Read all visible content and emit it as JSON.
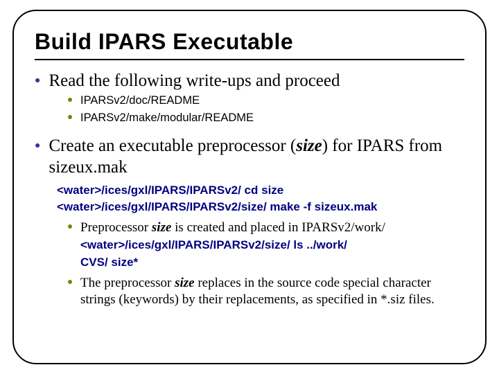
{
  "title": "Build IPARS Executable",
  "items": [
    {
      "text": "Read the following write-ups and proceed",
      "sub": [
        {
          "text": "IPARSv2/doc/README"
        },
        {
          "text": "IPARSv2/make/modular/README"
        }
      ]
    },
    {
      "text_pre": "Create an executable preprocessor (",
      "text_em": "size",
      "text_post": ") for IPARS from sizeux.mak",
      "code1": "<water>/ices/gxl/IPARS/IPARSv2/   cd size",
      "code2": "<water>/ices/gxl/IPARS/IPARSv2/size/   make -f sizeux.mak",
      "sub2": [
        {
          "pre": "Preprocessor ",
          "em": "size",
          "post": " is created and placed in IPARSv2/work/",
          "codeA": "<water>/ices/gxl/IPARS/IPARSv2/size/   ls ../work/",
          "codeB": "CVS/  size*"
        },
        {
          "pre": "The preprocessor ",
          "em": "size",
          "post": " replaces in the source code special character strings (keywords) by their replacements, as specified in *.siz files."
        }
      ]
    }
  ]
}
